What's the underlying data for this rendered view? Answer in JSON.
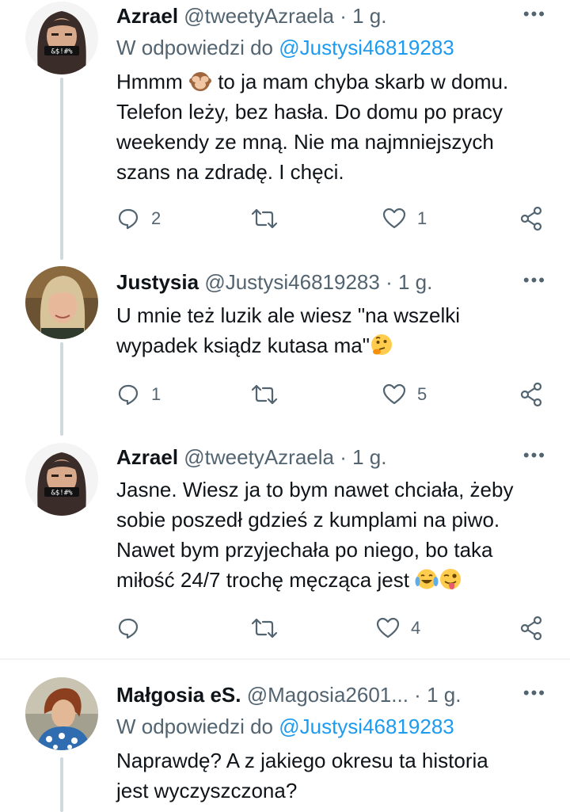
{
  "tweets": [
    {
      "name": "Azrael",
      "handle": "@tweetyAzraela",
      "time": "1 g.",
      "reply_prefix": "W odpowiedzi do",
      "reply_to": "@Justysi46819283",
      "lines": [
        [
          "Hmmm ",
          " to ja mam chyba skarb w domu."
        ],
        "Telefon leży, bez hasła. Do domu po pracy",
        "weekendy ze mną. Nie ma najmniejszych",
        "szans na zdradę. I chęci."
      ],
      "avatar_text": "&$!#%",
      "replies": "2",
      "retweets": "",
      "likes": "1"
    },
    {
      "name": "Justysia",
      "handle": "@Justysi46819283",
      "time": "1 g.",
      "lines": [
        "U mnie też luzik ale wiesz \"na wszelki",
        "wypadek ksiądz kutasa ma\""
      ],
      "replies": "1",
      "retweets": "",
      "likes": "5"
    },
    {
      "name": "Azrael",
      "handle": "@tweetyAzraela",
      "time": "1 g.",
      "lines": [
        "Jasne. Wiesz ja to bym nawet chciała, żeby",
        "sobie poszedł gdzieś z kumplami na piwo.",
        "Nawet bym przyjechała po niego, bo taka",
        "miłość 24/7 trochę męcząca jest"
      ],
      "avatar_text": "&$!#%",
      "replies": "",
      "retweets": "",
      "likes": "4"
    },
    {
      "name": "Małgosia eS.",
      "handle": "@Magosia2601...",
      "time": "1 g.",
      "reply_prefix": "W odpowiedzi do",
      "reply_to": "@Justysi46819283",
      "lines": [
        "Naprawdę? A z jakiego okresu ta historia",
        "jest wyczyszczona?"
      ]
    }
  ],
  "separator": "·",
  "more_label": "•••",
  "icons": {
    "reply": "reply-icon",
    "retweet": "retweet-icon",
    "like": "heart-icon",
    "share": "share-icon"
  },
  "colors": {
    "text": "#0f1419",
    "secondary": "#536471",
    "link": "#1d9bf0",
    "thread_line": "#cfd9de",
    "divider": "#eff3f4"
  }
}
